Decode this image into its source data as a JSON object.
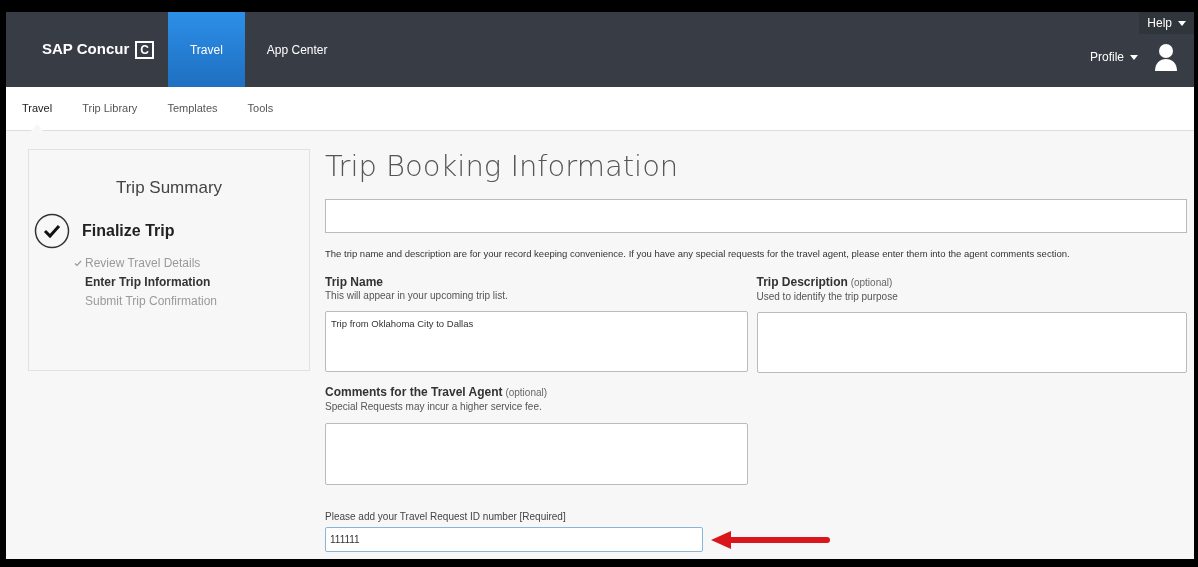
{
  "top_bar": {
    "logo": "SAP Concur",
    "logo_mark": "C",
    "nav": [
      {
        "label": "Travel",
        "selected": true
      },
      {
        "label": "App Center",
        "selected": false
      }
    ],
    "help": "Help",
    "profile": "Profile"
  },
  "sub_nav": [
    {
      "label": "Travel",
      "selected": true
    },
    {
      "label": "Trip Library",
      "selected": false
    },
    {
      "label": "Templates",
      "selected": false
    },
    {
      "label": "Tools",
      "selected": false
    }
  ],
  "trip_summary": {
    "title": "Trip Summary",
    "stage": "Finalize Trip",
    "steps": [
      {
        "label": "Review Travel Details",
        "checked": true,
        "selected": false
      },
      {
        "label": "Enter Trip Information",
        "checked": false,
        "selected": true
      },
      {
        "label": "Submit Trip Confirmation",
        "checked": false,
        "selected": false
      }
    ]
  },
  "form": {
    "title": "Trip Booking Information",
    "intro": "The trip name and description are for your record keeping convenience. If you have any special requests for the travel agent, please enter them into the agent comments section.",
    "trip_name": {
      "label": "Trip Name",
      "hint": "This will appear in your upcoming trip list.",
      "value": "Trip from Oklahoma City to Dallas"
    },
    "trip_description": {
      "label": "Trip Description",
      "note": "(optional)",
      "hint": "Used to identify the trip purpose"
    },
    "comments": {
      "label": "Comments for the Travel Agent",
      "note": "(optional)",
      "hint": "Special Requests may incur a higher service fee."
    },
    "request_id": {
      "label": "Please add your Travel Request ID number [Required]",
      "value": "111111"
    }
  }
}
